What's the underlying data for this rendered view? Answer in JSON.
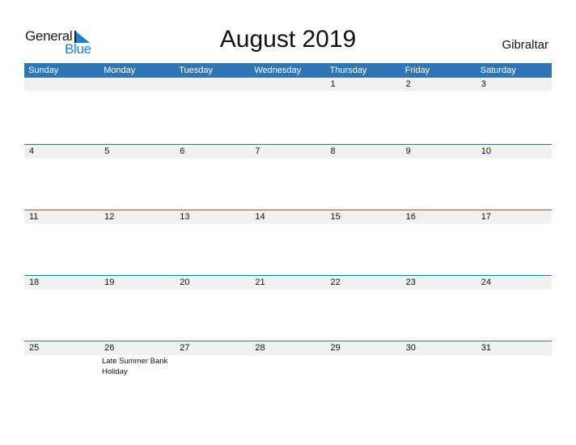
{
  "logo": {
    "general": "General",
    "blue": "Blue",
    "accent": "#1f7fce"
  },
  "title": "August 2019",
  "country": "Gibraltar",
  "colors": {
    "header_bg": "#2e75b6",
    "row_bg": "#f1f1f1"
  },
  "weekdays": [
    "Sunday",
    "Monday",
    "Tuesday",
    "Wednesday",
    "Thursday",
    "Friday",
    "Saturday"
  ],
  "weeks": [
    {
      "days": [
        "",
        "",
        "",
        "",
        "1",
        "2",
        "3"
      ],
      "events": [
        "",
        "",
        "",
        "",
        "",
        "",
        ""
      ]
    },
    {
      "days": [
        "4",
        "5",
        "6",
        "7",
        "8",
        "9",
        "10"
      ],
      "events": [
        "",
        "",
        "",
        "",
        "",
        "",
        ""
      ]
    },
    {
      "days": [
        "11",
        "12",
        "13",
        "14",
        "15",
        "16",
        "17"
      ],
      "events": [
        "",
        "",
        "",
        "",
        "",
        "",
        ""
      ]
    },
    {
      "days": [
        "18",
        "19",
        "20",
        "21",
        "22",
        "23",
        "24"
      ],
      "events": [
        "",
        "",
        "",
        "",
        "",
        "",
        ""
      ]
    },
    {
      "days": [
        "25",
        "26",
        "27",
        "28",
        "29",
        "30",
        "31"
      ],
      "events": [
        "",
        "Late Summer Bank Holiday",
        "",
        "",
        "",
        "",
        ""
      ]
    }
  ]
}
